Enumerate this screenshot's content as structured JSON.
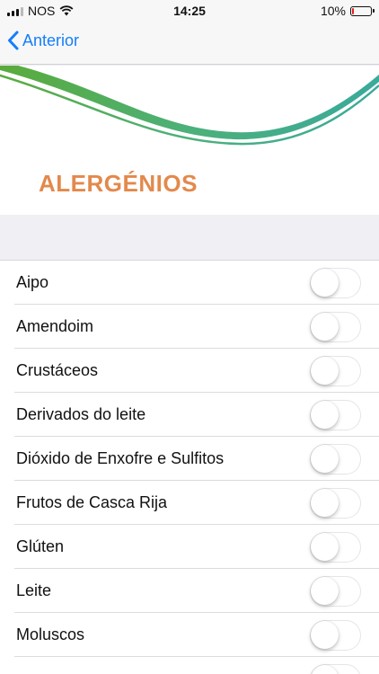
{
  "status_bar": {
    "carrier": "NOS",
    "time": "14:25",
    "battery_percent": "10%",
    "battery_level": 0.1,
    "battery_color": "#e02020"
  },
  "nav": {
    "back_label": "Anterior",
    "accent": "#157efb"
  },
  "banner": {
    "title": "ALERGÉNIOS",
    "title_color": "#e3894c"
  },
  "allergens": [
    {
      "label": "Aipo",
      "on": false
    },
    {
      "label": "Amendoim",
      "on": false
    },
    {
      "label": "Crustáceos",
      "on": false
    },
    {
      "label": "Derivados do leite",
      "on": false
    },
    {
      "label": "Dióxido de Enxofre e Sulfitos",
      "on": false
    },
    {
      "label": "Frutos de Casca Rija",
      "on": false
    },
    {
      "label": "Glúten",
      "on": false
    },
    {
      "label": "Leite",
      "on": false
    },
    {
      "label": "Moluscos",
      "on": false
    },
    {
      "label": "",
      "on": false
    }
  ]
}
